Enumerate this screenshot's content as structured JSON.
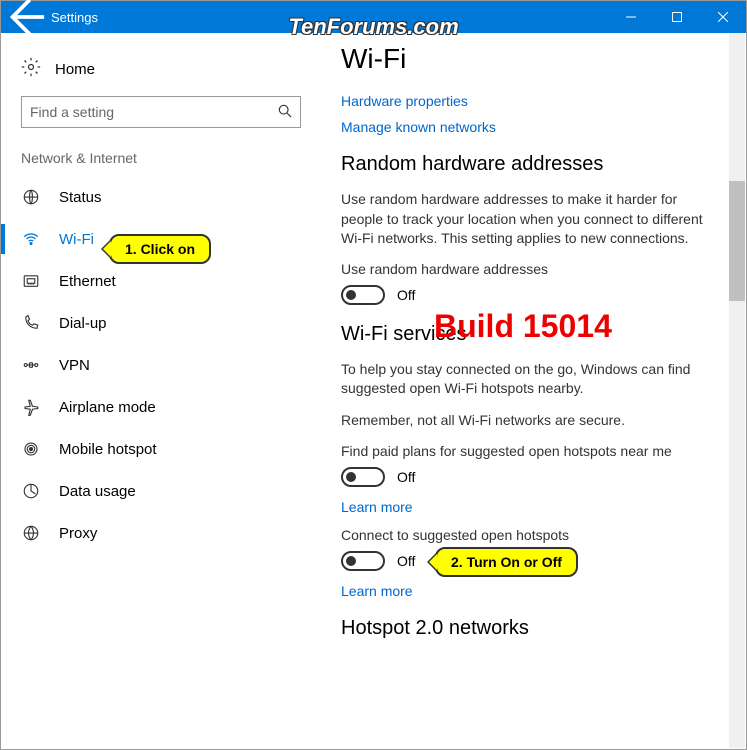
{
  "window": {
    "title": "Settings",
    "watermark": "TenForums.com"
  },
  "sidebar": {
    "home": "Home",
    "search_placeholder": "Find a setting",
    "category": "Network & Internet",
    "items": [
      {
        "label": "Status"
      },
      {
        "label": "Wi-Fi"
      },
      {
        "label": "Ethernet"
      },
      {
        "label": "Dial-up"
      },
      {
        "label": "VPN"
      },
      {
        "label": "Airplane mode"
      },
      {
        "label": "Mobile hotspot"
      },
      {
        "label": "Data usage"
      },
      {
        "label": "Proxy"
      }
    ]
  },
  "page": {
    "title": "Wi-Fi",
    "links": {
      "hardware": "Hardware properties",
      "known_networks": "Manage known networks"
    },
    "random_hw": {
      "heading": "Random hardware addresses",
      "desc": "Use random hardware addresses to make it harder for people to track your location when you connect to different Wi-Fi networks. This setting applies to new connections.",
      "label": "Use random hardware addresses",
      "state": "Off"
    },
    "services": {
      "heading": "Wi-Fi services",
      "desc1": "To help you stay connected on the go, Windows can find suggested open Wi-Fi hotspots nearby.",
      "desc2": "Remember, not all Wi-Fi networks are secure.",
      "paid_label": "Find paid plans for suggested open hotspots near me",
      "paid_state": "Off",
      "learn_more": "Learn more",
      "connect_label": "Connect to suggested open hotspots",
      "connect_state": "Off"
    },
    "hotspot2": {
      "heading": "Hotspot 2.0 networks"
    }
  },
  "annotations": {
    "callout1": "1. Click on",
    "callout2": "2. Turn On or Off",
    "build": "Build 15014"
  }
}
